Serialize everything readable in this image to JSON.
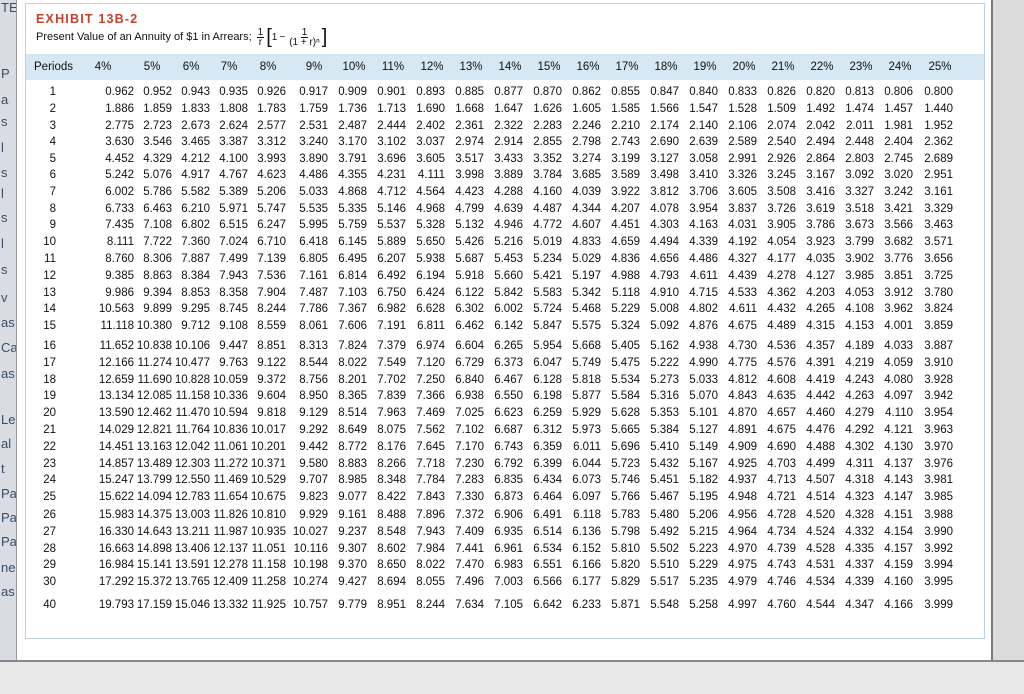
{
  "exhibit": {
    "number": "EXHIBIT 13B-2",
    "title": "Present Value of an Annuity of $1 in Arrears;",
    "formula": {
      "one_over": "1",
      "r": "r",
      "one": "1",
      "minus": "−",
      "denominator": "(1 + r)ⁿ"
    }
  },
  "table": {
    "period_header": "Periods",
    "rates": [
      "4%",
      "5%",
      "6%",
      "7%",
      "8%",
      "9%",
      "10%",
      "11%",
      "12%",
      "13%",
      "14%",
      "15%",
      "16%",
      "17%",
      "18%",
      "19%",
      "20%",
      "21%",
      "22%",
      "23%",
      "24%",
      "25%"
    ],
    "rows": [
      {
        "period": "1",
        "values": [
          "0.962",
          "0.952",
          "0.943",
          "0.935",
          "0.926",
          "0.917",
          "0.909",
          "0.901",
          "0.893",
          "0.885",
          "0.877",
          "0.870",
          "0.862",
          "0.855",
          "0.847",
          "0.840",
          "0.833",
          "0.826",
          "0.820",
          "0.813",
          "0.806",
          "0.800"
        ]
      },
      {
        "period": "2",
        "values": [
          "1.886",
          "1.859",
          "1.833",
          "1.808",
          "1.783",
          "1.759",
          "1.736",
          "1.713",
          "1.690",
          "1.668",
          "1.647",
          "1.626",
          "1.605",
          "1.585",
          "1.566",
          "1.547",
          "1.528",
          "1.509",
          "1.492",
          "1.474",
          "1.457",
          "1.440"
        ]
      },
      {
        "period": "3",
        "values": [
          "2.775",
          "2.723",
          "2.673",
          "2.624",
          "2.577",
          "2.531",
          "2.487",
          "2.444",
          "2.402",
          "2.361",
          "2.322",
          "2.283",
          "2.246",
          "2.210",
          "2.174",
          "2.140",
          "2.106",
          "2.074",
          "2.042",
          "2.011",
          "1.981",
          "1.952"
        ]
      },
      {
        "period": "4",
        "values": [
          "3.630",
          "3.546",
          "3.465",
          "3.387",
          "3.312",
          "3.240",
          "3.170",
          "3.102",
          "3.037",
          "2.974",
          "2.914",
          "2.855",
          "2.798",
          "2.743",
          "2.690",
          "2.639",
          "2.589",
          "2.540",
          "2.494",
          "2.448",
          "2.404",
          "2.362"
        ]
      },
      {
        "period": "5",
        "values": [
          "4.452",
          "4.329",
          "4.212",
          "4.100",
          "3.993",
          "3.890",
          "3.791",
          "3.696",
          "3.605",
          "3.517",
          "3.433",
          "3.352",
          "3.274",
          "3.199",
          "3.127",
          "3.058",
          "2.991",
          "2.926",
          "2.864",
          "2.803",
          "2.745",
          "2.689"
        ]
      },
      {
        "period": "6",
        "values": [
          "5.242",
          "5.076",
          "4.917",
          "4.767",
          "4.623",
          "4.486",
          "4.355",
          "4.231",
          "4.111",
          "3.998",
          "3.889",
          "3.784",
          "3.685",
          "3.589",
          "3.498",
          "3.410",
          "3.326",
          "3.245",
          "3.167",
          "3.092",
          "3.020",
          "2.951"
        ]
      },
      {
        "period": "7",
        "values": [
          "6.002",
          "5.786",
          "5.582",
          "5.389",
          "5.206",
          "5.033",
          "4.868",
          "4.712",
          "4.564",
          "4.423",
          "4.288",
          "4.160",
          "4.039",
          "3.922",
          "3.812",
          "3.706",
          "3.605",
          "3.508",
          "3.416",
          "3.327",
          "3.242",
          "3.161"
        ]
      },
      {
        "period": "8",
        "values": [
          "6.733",
          "6.463",
          "6.210",
          "5.971",
          "5.747",
          "5.535",
          "5.335",
          "5.146",
          "4.968",
          "4.799",
          "4.639",
          "4.487",
          "4.344",
          "4.207",
          "4.078",
          "3.954",
          "3.837",
          "3.726",
          "3.619",
          "3.518",
          "3.421",
          "3.329"
        ]
      },
      {
        "period": "9",
        "values": [
          "7.435",
          "7.108",
          "6.802",
          "6.515",
          "6.247",
          "5.995",
          "5.759",
          "5.537",
          "5.328",
          "5.132",
          "4.946",
          "4.772",
          "4.607",
          "4.451",
          "4.303",
          "4.163",
          "4.031",
          "3.905",
          "3.786",
          "3.673",
          "3.566",
          "3.463"
        ]
      },
      {
        "period": "10",
        "values": [
          "8.111",
          "7.722",
          "7.360",
          "7.024",
          "6.710",
          "6.418",
          "6.145",
          "5.889",
          "5.650",
          "5.426",
          "5.216",
          "5.019",
          "4.833",
          "4.659",
          "4.494",
          "4.339",
          "4.192",
          "4.054",
          "3.923",
          "3.799",
          "3.682",
          "3.571"
        ]
      },
      {
        "period": "11",
        "values": [
          "8.760",
          "8.306",
          "7.887",
          "7.499",
          "7.139",
          "6.805",
          "6.495",
          "6.207",
          "5.938",
          "5.687",
          "5.453",
          "5.234",
          "5.029",
          "4.836",
          "4.656",
          "4.486",
          "4.327",
          "4.177",
          "4.035",
          "3.902",
          "3.776",
          "3.656"
        ]
      },
      {
        "period": "12",
        "values": [
          "9.385",
          "8.863",
          "8.384",
          "7.943",
          "7.536",
          "7.161",
          "6.814",
          "6.492",
          "6.194",
          "5.918",
          "5.660",
          "5.421",
          "5.197",
          "4.988",
          "4.793",
          "4.611",
          "4.439",
          "4.278",
          "4.127",
          "3.985",
          "3.851",
          "3.725"
        ]
      },
      {
        "period": "13",
        "values": [
          "9.986",
          "9.394",
          "8.853",
          "8.358",
          "7.904",
          "7.487",
          "7.103",
          "6.750",
          "6.424",
          "6.122",
          "5.842",
          "5.583",
          "5.342",
          "5.118",
          "4.910",
          "4.715",
          "4.533",
          "4.362",
          "4.203",
          "4.053",
          "3.912",
          "3.780"
        ]
      },
      {
        "period": "14",
        "values": [
          "10.563",
          "9.899",
          "9.295",
          "8.745",
          "8.244",
          "7.786",
          "7.367",
          "6.982",
          "6.628",
          "6.302",
          "6.002",
          "5.724",
          "5.468",
          "5.229",
          "5.008",
          "4.802",
          "4.611",
          "4.432",
          "4.265",
          "4.108",
          "3.962",
          "3.824"
        ]
      },
      {
        "period": "15",
        "values": [
          "11.118",
          "10.380",
          "9.712",
          "9.108",
          "8.559",
          "8.061",
          "7.606",
          "7.191",
          "6.811",
          "6.462",
          "6.142",
          "5.847",
          "5.575",
          "5.324",
          "5.092",
          "4.876",
          "4.675",
          "4.489",
          "4.315",
          "4.153",
          "4.001",
          "3.859"
        ]
      },
      {
        "period": "16",
        "values": [
          "11.652",
          "10.838",
          "10.106",
          "9.447",
          "8.851",
          "8.313",
          "7.824",
          "7.379",
          "6.974",
          "6.604",
          "6.265",
          "5.954",
          "5.668",
          "5.405",
          "5.162",
          "4.938",
          "4.730",
          "4.536",
          "4.357",
          "4.189",
          "4.033",
          "3.887"
        ]
      },
      {
        "period": "17",
        "values": [
          "12.166",
          "11.274",
          "10.477",
          "9.763",
          "9.122",
          "8.544",
          "8.022",
          "7.549",
          "7.120",
          "6.729",
          "6.373",
          "6.047",
          "5.749",
          "5.475",
          "5.222",
          "4.990",
          "4.775",
          "4.576",
          "4.391",
          "4.219",
          "4.059",
          "3.910"
        ]
      },
      {
        "period": "18",
        "values": [
          "12.659",
          "11.690",
          "10.828",
          "10.059",
          "9.372",
          "8.756",
          "8.201",
          "7.702",
          "7.250",
          "6.840",
          "6.467",
          "6.128",
          "5.818",
          "5.534",
          "5.273",
          "5.033",
          "4.812",
          "4.608",
          "4.419",
          "4.243",
          "4.080",
          "3.928"
        ]
      },
      {
        "period": "19",
        "values": [
          "13.134",
          "12.085",
          "11.158",
          "10.336",
          "9.604",
          "8.950",
          "8.365",
          "7.839",
          "7.366",
          "6.938",
          "6.550",
          "6.198",
          "5.877",
          "5.584",
          "5.316",
          "5.070",
          "4.843",
          "4.635",
          "4.442",
          "4.263",
          "4.097",
          "3.942"
        ]
      },
      {
        "period": "20",
        "values": [
          "13.590",
          "12.462",
          "11.470",
          "10.594",
          "9.818",
          "9.129",
          "8.514",
          "7.963",
          "7.469",
          "7.025",
          "6.623",
          "6.259",
          "5.929",
          "5.628",
          "5.353",
          "5.101",
          "4.870",
          "4.657",
          "4.460",
          "4.279",
          "4.110",
          "3.954"
        ]
      },
      {
        "period": "21",
        "values": [
          "14.029",
          "12.821",
          "11.764",
          "10.836",
          "10.017",
          "9.292",
          "8.649",
          "8.075",
          "7.562",
          "7.102",
          "6.687",
          "6.312",
          "5.973",
          "5.665",
          "5.384",
          "5.127",
          "4.891",
          "4.675",
          "4.476",
          "4.292",
          "4.121",
          "3.963"
        ]
      },
      {
        "period": "22",
        "values": [
          "14.451",
          "13.163",
          "12.042",
          "11.061",
          "10.201",
          "9.442",
          "8.772",
          "8.176",
          "7.645",
          "7.170",
          "6.743",
          "6.359",
          "6.011",
          "5.696",
          "5.410",
          "5.149",
          "4.909",
          "4.690",
          "4.488",
          "4.302",
          "4.130",
          "3.970"
        ]
      },
      {
        "period": "23",
        "values": [
          "14.857",
          "13.489",
          "12.303",
          "11.272",
          "10.371",
          "9.580",
          "8.883",
          "8.266",
          "7.718",
          "7.230",
          "6.792",
          "6.399",
          "6.044",
          "5.723",
          "5.432",
          "5.167",
          "4.925",
          "4.703",
          "4.499",
          "4.311",
          "4.137",
          "3.976"
        ]
      },
      {
        "period": "24",
        "values": [
          "15.247",
          "13.799",
          "12.550",
          "11.469",
          "10.529",
          "9.707",
          "8.985",
          "8.348",
          "7.784",
          "7.283",
          "6.835",
          "6.434",
          "6.073",
          "5.746",
          "5.451",
          "5.182",
          "4.937",
          "4.713",
          "4.507",
          "4.318",
          "4.143",
          "3.981"
        ]
      },
      {
        "period": "25",
        "values": [
          "15.622",
          "14.094",
          "12.783",
          "11.654",
          "10.675",
          "9.823",
          "9.077",
          "8.422",
          "7.843",
          "7.330",
          "6.873",
          "6.464",
          "6.097",
          "5.766",
          "5.467",
          "5.195",
          "4.948",
          "4.721",
          "4.514",
          "4.323",
          "4.147",
          "3.985"
        ]
      },
      {
        "period": "26",
        "values": [
          "15.983",
          "14.375",
          "13.003",
          "11.826",
          "10.810",
          "9.929",
          "9.161",
          "8.488",
          "7.896",
          "7.372",
          "6.906",
          "6.491",
          "6.118",
          "5.783",
          "5.480",
          "5.206",
          "4.956",
          "4.728",
          "4.520",
          "4.328",
          "4.151",
          "3.988"
        ]
      },
      {
        "period": "27",
        "values": [
          "16.330",
          "14.643",
          "13.211",
          "11.987",
          "10.935",
          "10.027",
          "9.237",
          "8.548",
          "7.943",
          "7.409",
          "6.935",
          "6.514",
          "6.136",
          "5.798",
          "5.492",
          "5.215",
          "4.964",
          "4.734",
          "4.524",
          "4.332",
          "4.154",
          "3.990"
        ]
      },
      {
        "period": "28",
        "values": [
          "16.663",
          "14.898",
          "13.406",
          "12.137",
          "11.051",
          "10.116",
          "9.307",
          "8.602",
          "7.984",
          "7.441",
          "6.961",
          "6.534",
          "6.152",
          "5.810",
          "5.502",
          "5.223",
          "4.970",
          "4.739",
          "4.528",
          "4.335",
          "4.157",
          "3.992"
        ]
      },
      {
        "period": "29",
        "values": [
          "16.984",
          "15.141",
          "13.591",
          "12.278",
          "11.158",
          "10.198",
          "9.370",
          "8.650",
          "8.022",
          "7.470",
          "6.983",
          "6.551",
          "6.166",
          "5.820",
          "5.510",
          "5.229",
          "4.975",
          "4.743",
          "4.531",
          "4.337",
          "4.159",
          "3.994"
        ]
      },
      {
        "period": "30",
        "values": [
          "17.292",
          "15.372",
          "13.765",
          "12.409",
          "11.258",
          "10.274",
          "9.427",
          "8.694",
          "8.055",
          "7.496",
          "7.003",
          "6.566",
          "6.177",
          "5.829",
          "5.517",
          "5.235",
          "4.979",
          "4.746",
          "4.534",
          "4.339",
          "4.160",
          "3.995"
        ]
      },
      {
        "period": "40",
        "values": [
          "19.793",
          "17.159",
          "15.046",
          "13.332",
          "11.925",
          "10.757",
          "9.779",
          "8.951",
          "8.244",
          "7.634",
          "7.105",
          "6.642",
          "6.233",
          "5.871",
          "5.548",
          "5.258",
          "4.997",
          "4.760",
          "4.544",
          "4.347",
          "4.166",
          "3.999"
        ]
      }
    ]
  },
  "background_fragments": [
    "TE",
    "P",
    "a",
    "s",
    "l",
    "s",
    "l",
    "s",
    "l",
    "s",
    "v",
    "as",
    "Ca",
    "as",
    "Le",
    "al",
    "t",
    "Pa",
    "Pa",
    "Pa",
    "ne",
    "as"
  ]
}
